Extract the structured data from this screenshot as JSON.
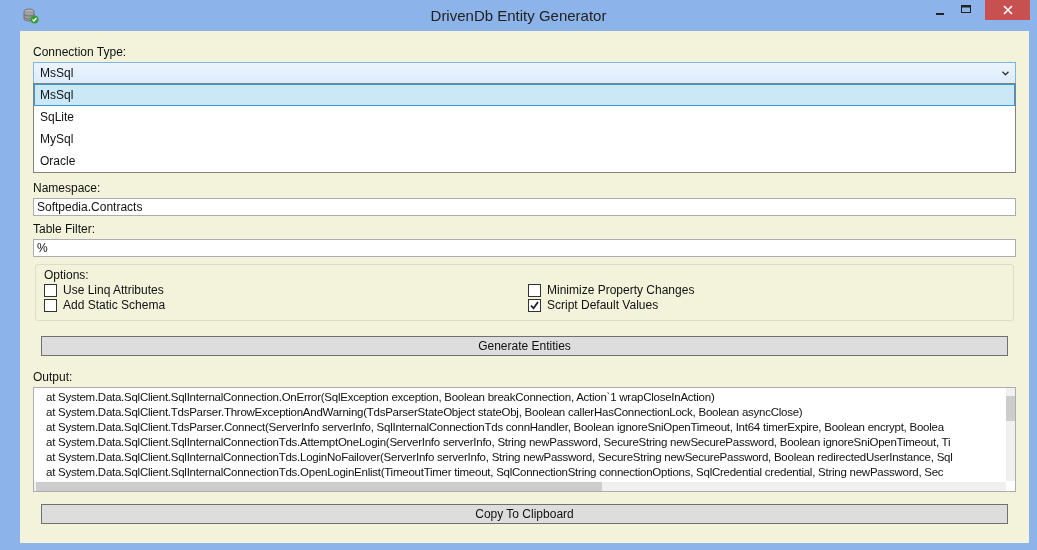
{
  "window": {
    "title": "DrivenDb Entity Generator"
  },
  "connection_type": {
    "label": "Connection Type:",
    "value": "MsSql",
    "expanded": true,
    "options": [
      {
        "label": "MsSql",
        "selected": true
      },
      {
        "label": "SqLite",
        "selected": false
      },
      {
        "label": "MySql",
        "selected": false
      },
      {
        "label": "Oracle",
        "selected": false
      }
    ]
  },
  "namespace": {
    "label": "Namespace:",
    "value": "Softpedia.Contracts"
  },
  "table_filter": {
    "label": "Table Filter:",
    "value": "%"
  },
  "options": {
    "label": "Options:",
    "items": [
      {
        "label": "Use Linq Attributes",
        "checked": false
      },
      {
        "label": "Minimize Property Changes",
        "checked": false
      },
      {
        "label": "Add Static Schema",
        "checked": false
      },
      {
        "label": "Script Default Values",
        "checked": true
      }
    ]
  },
  "generate_button": "Generate Entities",
  "output": {
    "label": "Output:",
    "lines": [
      "at System.Data.SqlClient.SqlInternalConnection.OnError(SqlException exception, Boolean breakConnection, Action`1 wrapCloseInAction)",
      "at System.Data.SqlClient.TdsParser.ThrowExceptionAndWarning(TdsParserStateObject stateObj, Boolean callerHasConnectionLock, Boolean asyncClose)",
      "at System.Data.SqlClient.TdsParser.Connect(ServerInfo serverInfo, SqlInternalConnectionTds connHandler, Boolean ignoreSniOpenTimeout, Int64 timerExpire, Boolean encrypt, Boolea",
      "at System.Data.SqlClient.SqlInternalConnectionTds.AttemptOneLogin(ServerInfo serverInfo, String newPassword, SecureString newSecurePassword, Boolean ignoreSniOpenTimeout, Ti",
      "at System.Data.SqlClient.SqlInternalConnectionTds.LoginNoFailover(ServerInfo serverInfo, String newPassword, SecureString newSecurePassword, Boolean redirectedUserInstance, Sql",
      "at System.Data.SqlClient.SqlInternalConnectionTds.OpenLoginEnlist(TimeoutTimer timeout, SqlConnectionString connectionOptions, SqlCredential credential, String newPassword, Sec"
    ]
  },
  "copy_button": "Copy To Clipboard"
}
